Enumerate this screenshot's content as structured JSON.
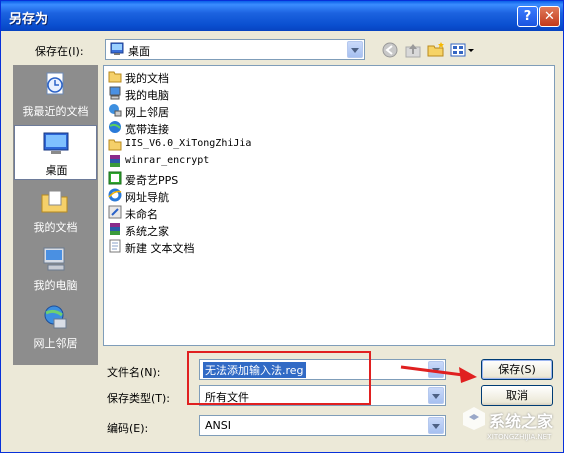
{
  "window": {
    "title": "另存为",
    "help": "?",
    "close": "✕"
  },
  "save_in": {
    "label": "保存在(I):",
    "value": "桌面",
    "icon": "desktop-icon"
  },
  "toolbar": {
    "back": "back-icon",
    "up": "up-folder-icon",
    "new_folder": "new-folder-icon",
    "views": "views-icon"
  },
  "places": [
    {
      "label": "我最近的文档",
      "icon": "recent-docs-icon"
    },
    {
      "label": "桌面",
      "icon": "desktop-icon",
      "selected": true
    },
    {
      "label": "我的文档",
      "icon": "my-docs-icon"
    },
    {
      "label": "我的电脑",
      "icon": "my-computer-icon"
    },
    {
      "label": "网上邻居",
      "icon": "network-icon"
    }
  ],
  "files": [
    {
      "name": "我的文档",
      "icon": "my-docs-icon"
    },
    {
      "name": "我的电脑",
      "icon": "my-computer-icon"
    },
    {
      "name": "网上邻居",
      "icon": "network-icon"
    },
    {
      "name": "宽带连接",
      "icon": "broadband-icon"
    },
    {
      "name": "IIS_V6.0_XiTongZhiJia",
      "icon": "folder-icon"
    },
    {
      "name": "winrar_encrypt",
      "icon": "winrar-icon"
    },
    {
      "name": "爱奇艺PPS",
      "icon": "pps-icon"
    },
    {
      "name": "网址导航",
      "icon": "ie-icon"
    },
    {
      "name": "未命名",
      "icon": "shortcut-icon"
    },
    {
      "name": "系统之家",
      "icon": "winrar-icon"
    },
    {
      "name": "新建 文本文档",
      "icon": "text-file-icon"
    }
  ],
  "filename": {
    "label": "文件名(N):",
    "value": "无法添加输入法.reg"
  },
  "filetype": {
    "label": "保存类型(T):",
    "value": "所有文件"
  },
  "encoding": {
    "label": "编码(E):",
    "value": "ANSI"
  },
  "buttons": {
    "save": "保存(S)",
    "cancel": "取消"
  },
  "watermark": {
    "text": "系统之家",
    "url": "XITONGZHIJIA.NET"
  },
  "colors": {
    "title_bar": "#0a5fe8",
    "highlight": "#316ac5",
    "annotation": "#e02020"
  }
}
